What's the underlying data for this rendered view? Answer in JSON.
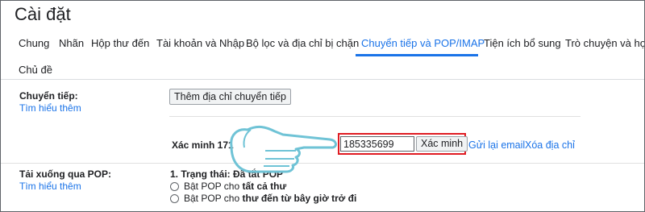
{
  "page": {
    "title": "Cài đặt"
  },
  "tabs": [
    {
      "label": "Chung",
      "active": false
    },
    {
      "label": "Nhãn",
      "active": false
    },
    {
      "label": "Hộp thư đến",
      "active": false
    },
    {
      "label": "Tài khoản và Nhập",
      "active": false
    },
    {
      "label": "Bộ lọc và địa chỉ bị chặn",
      "active": false
    },
    {
      "label": "Chuyển tiếp và POP/IMAP",
      "active": true
    },
    {
      "label": "Tiện ích bổ sung",
      "active": false
    },
    {
      "label": "Trò chuyện và họp",
      "active": false
    },
    {
      "label": "Chủ đề",
      "active": false
    }
  ],
  "forwarding": {
    "label": "Chuyển tiếp:",
    "learn_more": "Tìm hiểu thêm",
    "add_button": "Thêm địa chỉ chuyển tiếp",
    "verify_label": "Xác minh 171",
    "code_value": "185335699",
    "verify_button": "Xác minh",
    "resend_link": "Gửi lại email",
    "delete_link": "Xóa địa chỉ"
  },
  "pop": {
    "label": "Tải xuống qua POP:",
    "learn_more": "Tìm hiểu thêm",
    "status_prefix": "1. Trạng thái: ",
    "status_value": "Đã tắt POP",
    "option1_prefix": "Bật POP cho ",
    "option1_bold": "tất cả thư",
    "option2_prefix": "Bật POP cho ",
    "option2_bold": "thư đến từ bây giờ trở đi"
  },
  "colors": {
    "accent": "#1a73e8",
    "highlight": "#e01b22",
    "hand_outline": "#6fc3d6"
  },
  "icons": {
    "pointer": "pointing-hand-icon"
  }
}
